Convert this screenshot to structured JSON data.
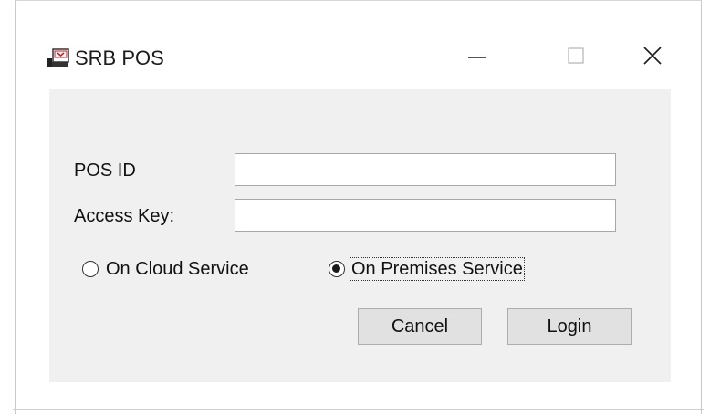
{
  "window": {
    "title": "SRB POS",
    "icon": "pos-terminal-icon",
    "controls": {
      "minimize_icon": "minimize-icon",
      "maximize_icon": "maximize-icon",
      "close_icon": "close-icon"
    }
  },
  "form": {
    "pos_id": {
      "label": "POS ID",
      "value": "",
      "placeholder": ""
    },
    "access_key": {
      "label": "Access Key:",
      "value": "",
      "placeholder": ""
    },
    "service_mode": {
      "options": [
        {
          "label": "On Cloud Service",
          "checked": false
        },
        {
          "label": "On Premises Service",
          "checked": true
        }
      ]
    },
    "buttons": {
      "cancel_label": "Cancel",
      "login_label": "Login"
    }
  },
  "colors": {
    "client_background": "#f0f0f0",
    "button_background": "#e1e1e1",
    "icon_red": "#c0202a"
  }
}
